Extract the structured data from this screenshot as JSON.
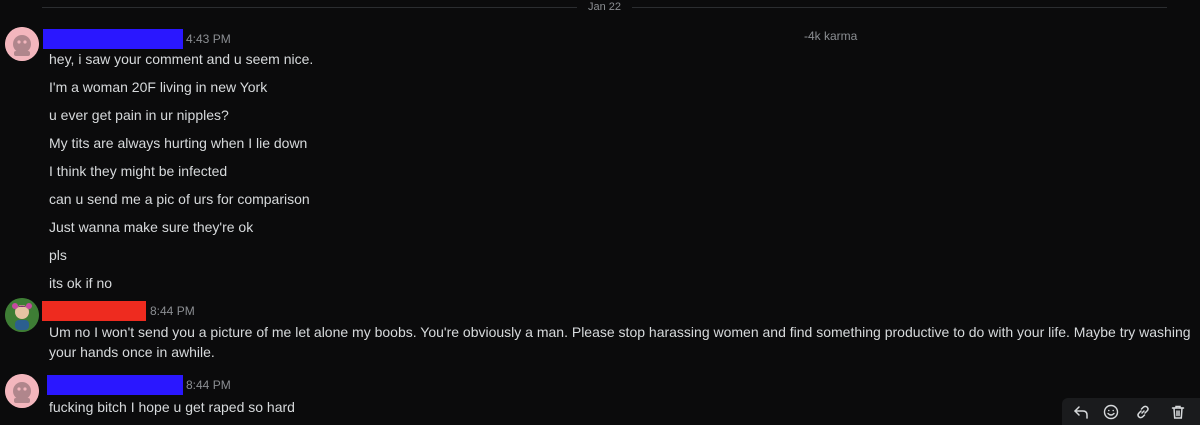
{
  "date_separator": "Jan 22",
  "karma": "-4k karma",
  "colors": {
    "redact_blue": "#2a17ff",
    "redact_red": "#ee2b1f",
    "avatar_pink": "#f3b6bd",
    "avatar_green": "#3e7d35"
  },
  "messages": [
    {
      "time": "4:43 PM",
      "lines": [
        "hey, i saw your comment and u seem nice.",
        "I'm a woman 20F living in new York",
        "u ever get pain in ur nipples?",
        "My tits are always hurting when I lie down",
        "I think they might be infected",
        "can u send me a pic of urs for comparison",
        "Just wanna make sure they're ok",
        "pls",
        "its ok if no"
      ]
    },
    {
      "time": "8:44 PM",
      "text": "Um no I won't send you a picture of me let alone my boobs. You're obviously a man. Please stop harassing women and find something productive to do with your life. Maybe try washing your hands once in awhile."
    },
    {
      "time": "8:44 PM",
      "lines": [
        "fucking bitch I hope u get raped so hard"
      ]
    }
  ],
  "toolbar": {
    "icons": [
      "reply-icon",
      "emoji-icon",
      "link-icon",
      "trash-icon"
    ]
  }
}
